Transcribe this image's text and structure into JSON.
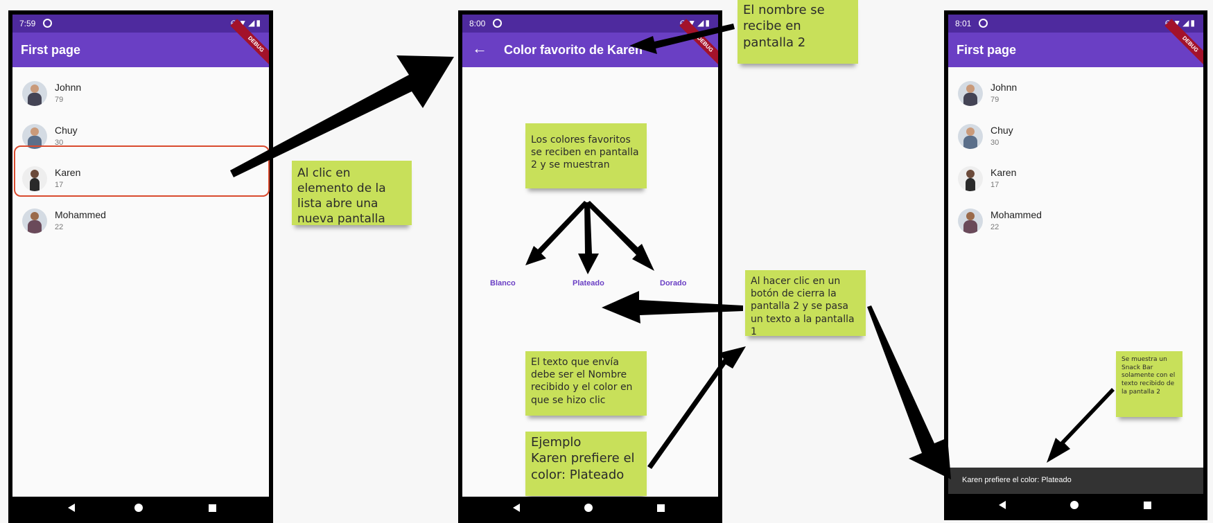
{
  "phone1": {
    "status_time": "7:59",
    "status_icons": "⊖▼◢▮",
    "banner": "DEBUG",
    "appbar_title": "First page",
    "items": [
      {
        "name": "Johnn",
        "age": "79"
      },
      {
        "name": "Chuy",
        "age": "30"
      },
      {
        "name": "Karen",
        "age": "17"
      },
      {
        "name": "Mohammed",
        "age": "22"
      }
    ]
  },
  "phone2": {
    "status_time": "8:00",
    "status_icons": "⊖▼◢▮",
    "banner": "DEBUG",
    "back_icon": "←",
    "appbar_title": "Color favorito de Karen",
    "buttons": [
      "Blanco",
      "Plateado",
      "Dorado"
    ]
  },
  "phone3": {
    "status_time": "8:01",
    "status_icons": "⊖▼◢▮",
    "banner": "DEBUG",
    "appbar_title": "First page",
    "items": [
      {
        "name": "Johnn",
        "age": "79"
      },
      {
        "name": "Chuy",
        "age": "30"
      },
      {
        "name": "Karen",
        "age": "17"
      },
      {
        "name": "Mohammed",
        "age": "22"
      }
    ],
    "snackbar": "Karen prefiere el color: Plateado"
  },
  "notes": {
    "nombre": "El nombre se recibe en pantalla 2",
    "clic_lista": "Al clic en elemento de la lista abre una nueva pantalla",
    "colores": "Los colores favoritos se reciben en pantalla 2 y se muestran",
    "hacer_clic": "Al hacer clic en un botón de cierra la pantalla 2 y se pasa un texto a la pantalla 1",
    "texto_envia": "El texto que envía debe ser el Nombre recibido y el color en que se hizo clic",
    "ejemplo": "Ejemplo\nKaren prefiere el color: Plateado",
    "snackbar_note": "Se muestra un Snack Bar solamente con el texto recibido de la pantalla 2"
  },
  "colors": {
    "appbar": "#6a3fc4",
    "statusbar": "#4e2a9e",
    "sticky": "#c8e05a",
    "highlight": "#d94a2e"
  }
}
